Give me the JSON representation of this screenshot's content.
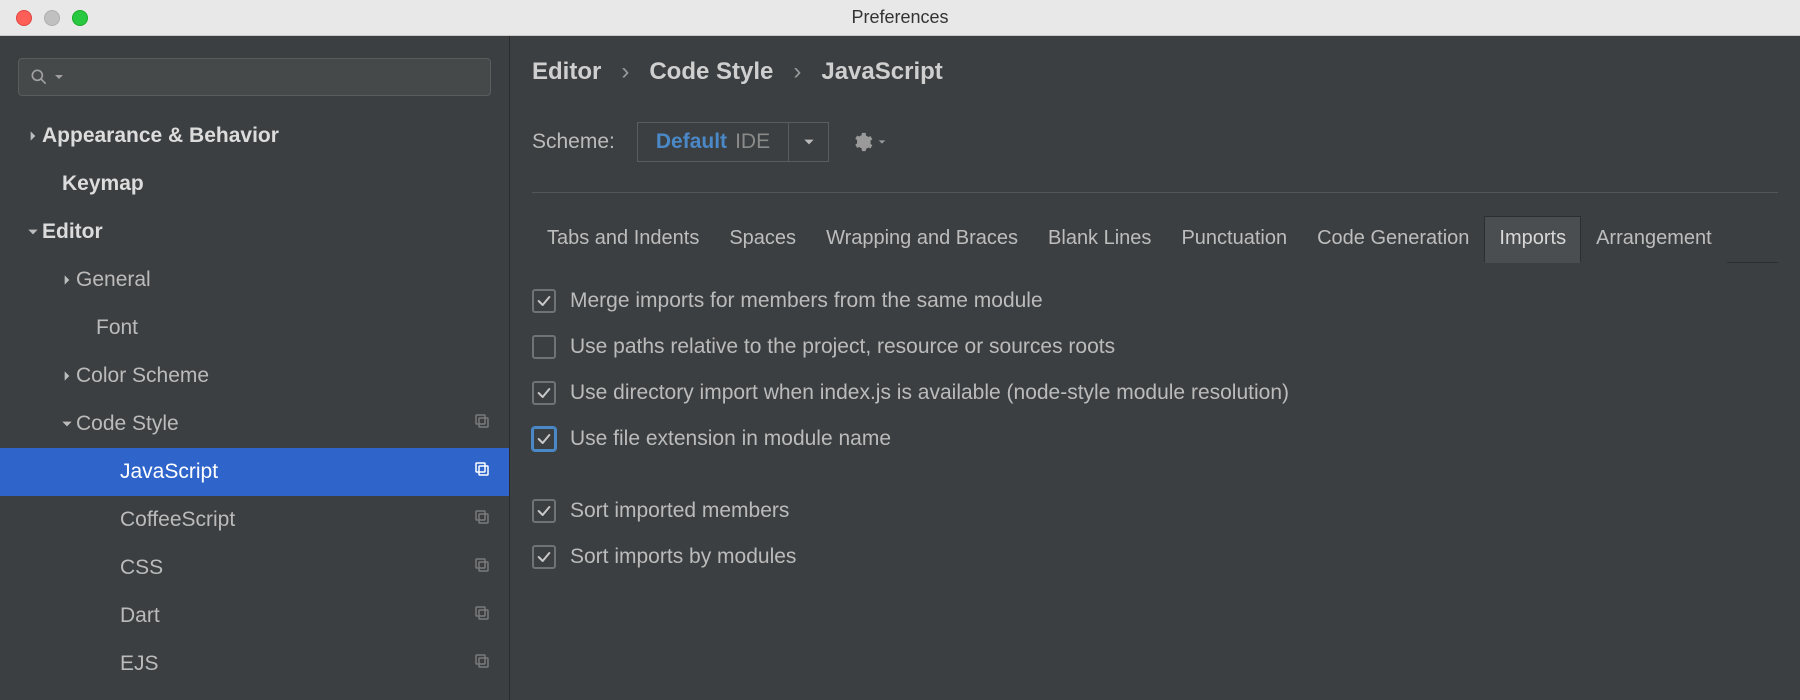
{
  "window": {
    "title": "Preferences"
  },
  "sidebar": {
    "search_placeholder": "",
    "items": [
      {
        "label": "Appearance & Behavior",
        "bold": true,
        "expandable": true,
        "expanded": false,
        "indent": 0
      },
      {
        "label": "Keymap",
        "bold": true,
        "expandable": false,
        "indent": "leaf-1"
      },
      {
        "label": "Editor",
        "bold": true,
        "expandable": true,
        "expanded": true,
        "indent": 0
      },
      {
        "label": "General",
        "expandable": true,
        "expanded": false,
        "indent": 1
      },
      {
        "label": "Font",
        "expandable": false,
        "indent": "leaf-2",
        "lpad": 96
      },
      {
        "label": "Color Scheme",
        "expandable": true,
        "expanded": false,
        "indent": 1
      },
      {
        "label": "Code Style",
        "expandable": true,
        "expanded": true,
        "indent": 1,
        "copy": true
      },
      {
        "label": "JavaScript",
        "expandable": false,
        "indent": "leaf-2",
        "copy": true,
        "selected": true
      },
      {
        "label": "CoffeeScript",
        "expandable": false,
        "indent": "leaf-2",
        "copy": true
      },
      {
        "label": "CSS",
        "expandable": false,
        "indent": "leaf-2",
        "copy": true
      },
      {
        "label": "Dart",
        "expandable": false,
        "indent": "leaf-2",
        "copy": true
      },
      {
        "label": "EJS",
        "expandable": false,
        "indent": "leaf-2",
        "copy": true
      }
    ]
  },
  "breadcrumb": [
    "Editor",
    "Code Style",
    "JavaScript"
  ],
  "scheme": {
    "label": "Scheme:",
    "value_primary": "Default",
    "value_secondary": "IDE"
  },
  "tabs": [
    {
      "label": "Tabs and Indents"
    },
    {
      "label": "Spaces"
    },
    {
      "label": "Wrapping and Braces"
    },
    {
      "label": "Blank Lines"
    },
    {
      "label": "Punctuation"
    },
    {
      "label": "Code Generation"
    },
    {
      "label": "Imports",
      "active": true
    },
    {
      "label": "Arrangement"
    }
  ],
  "options": [
    {
      "label": "Merge imports for members from the same module",
      "checked": true
    },
    {
      "label": "Use paths relative to the project, resource or sources roots",
      "checked": false
    },
    {
      "label": "Use directory import when index.js is available (node-style module resolution)",
      "checked": true
    },
    {
      "label": "Use file extension in module name",
      "checked": true,
      "focused": true
    },
    {
      "gap": true
    },
    {
      "label": "Sort imported members",
      "checked": true
    },
    {
      "label": "Sort imports by modules",
      "checked": true
    }
  ]
}
